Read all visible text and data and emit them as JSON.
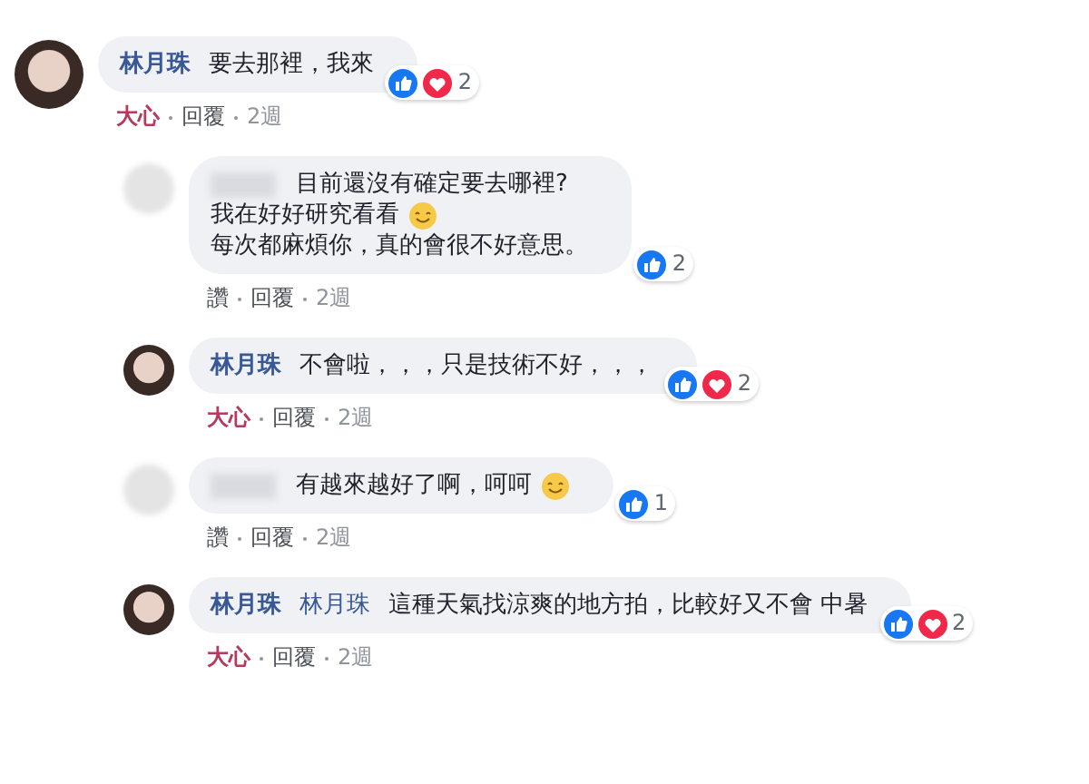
{
  "comments": [
    {
      "indent": false,
      "author": "林月珠",
      "lines": [
        {
          "text": "要去那裡，我來",
          "emoji": false
        }
      ],
      "reactions": {
        "icons": [
          {
            "kind": "like"
          },
          {
            "kind": "love"
          }
        ],
        "count": "2"
      },
      "actions": [
        {
          "label": "大心",
          "kind": "love"
        },
        {
          "label": "回覆",
          "kind": "reply"
        }
      ],
      "time": "2週"
    },
    {
      "indent": true,
      "lines": [
        {
          "text": "目前還沒有確定要去哪裡?",
          "emoji": false
        },
        {
          "text": "我在好好研究看看",
          "emoji": true
        },
        {
          "text": "每次都麻煩你，真的會很不好意思。",
          "emoji": false
        }
      ],
      "reactions": {
        "icons": [
          {
            "kind": "like"
          }
        ],
        "count": "2"
      },
      "actions": [
        {
          "label": "讚",
          "kind": "like"
        },
        {
          "label": "回覆",
          "kind": "reply"
        }
      ],
      "time": "2週"
    },
    {
      "indent": true,
      "author": "林月珠",
      "lines": [
        {
          "text": "不會啦，，，只是技術不好，，，",
          "emoji": false
        }
      ],
      "reactions": {
        "icons": [
          {
            "kind": "like"
          },
          {
            "kind": "love"
          }
        ],
        "count": "2"
      },
      "actions": [
        {
          "label": "大心",
          "kind": "love"
        },
        {
          "label": "回覆",
          "kind": "reply"
        }
      ],
      "time": "2週"
    },
    {
      "indent": true,
      "lines": [
        {
          "text": "有越來越好了啊，呵呵",
          "emoji": true
        }
      ],
      "reactions": {
        "icons": [
          {
            "kind": "like"
          }
        ],
        "count": "1"
      },
      "actions": [
        {
          "label": "讚",
          "kind": "like"
        },
        {
          "label": "回覆",
          "kind": "reply"
        }
      ],
      "time": "2週"
    },
    {
      "indent": true,
      "author": "林月珠",
      "mention": "林月珠",
      "lines": [
        {
          "text": "這種天氣找涼爽的地方拍，比較好又不會 中暑",
          "emoji": false
        }
      ],
      "reactions": {
        "icons": [
          {
            "kind": "like"
          },
          {
            "kind": "love"
          }
        ],
        "count": "2"
      },
      "actions": [
        {
          "label": "大心",
          "kind": "love"
        },
        {
          "label": "回覆",
          "kind": "reply"
        }
      ],
      "time": "2週"
    }
  ]
}
